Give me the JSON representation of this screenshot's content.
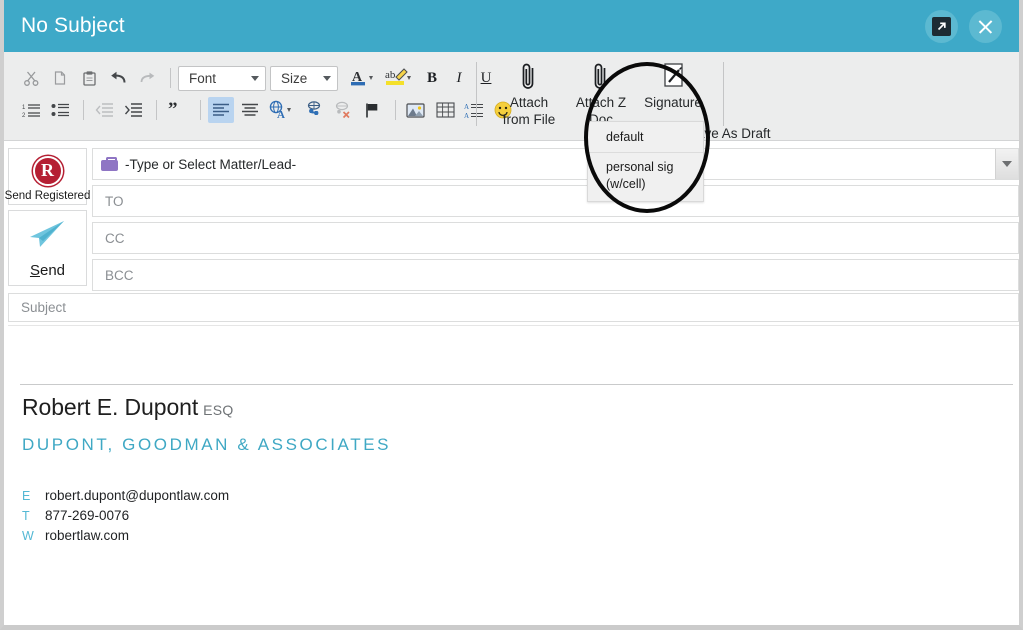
{
  "window": {
    "title": "No Subject",
    "popout_icon": "popout-arrow-icon",
    "close_icon": "close-icon",
    "header_color": "#3ea9c8"
  },
  "toolbar": {
    "row1": [
      {
        "name": "cut-button",
        "icon": "scissors-icon"
      },
      {
        "name": "copy-button",
        "icon": "copy-icon"
      },
      {
        "name": "paste-button",
        "icon": "clipboard-icon"
      },
      {
        "name": "undo-button",
        "icon": "undo-arrow-icon"
      },
      {
        "name": "redo-button",
        "icon": "redo-arrow-icon"
      }
    ],
    "font_select": {
      "label": "Font"
    },
    "size_select": {
      "label": "Size"
    },
    "row1_format": [
      {
        "name": "font-color-button",
        "icon": "font-color-icon"
      },
      {
        "name": "highlight-button",
        "icon": "highlighter-icon"
      },
      {
        "name": "bold-button",
        "icon": "bold-icon",
        "label": "B"
      },
      {
        "name": "italic-button",
        "icon": "italic-icon",
        "label": "I"
      },
      {
        "name": "underline-button",
        "icon": "underline-icon",
        "label": "U"
      }
    ],
    "row2": [
      {
        "name": "numbered-list-button",
        "icon": "numbered-list-icon"
      },
      {
        "name": "bullet-list-button",
        "icon": "bullet-list-icon"
      },
      {
        "name": "decrease-indent-button",
        "icon": "decrease-indent-icon"
      },
      {
        "name": "increase-indent-button",
        "icon": "increase-indent-icon"
      },
      {
        "name": "blockquote-button",
        "icon": "quote-icon"
      },
      {
        "name": "align-left-button",
        "icon": "align-left-icon"
      },
      {
        "name": "align-center-button",
        "icon": "align-center-icon"
      },
      {
        "name": "language-button",
        "icon": "globe-a-icon"
      },
      {
        "name": "insert-link-button",
        "icon": "link-icon"
      },
      {
        "name": "remove-link-button",
        "icon": "unlink-icon"
      },
      {
        "name": "flag-button",
        "icon": "flag-icon"
      },
      {
        "name": "insert-image-button",
        "icon": "image-icon"
      },
      {
        "name": "insert-table-button",
        "icon": "table-icon"
      },
      {
        "name": "paragraph-style-button",
        "icon": "paragraph-style-icon"
      },
      {
        "name": "emoji-button",
        "icon": "smiley-icon"
      }
    ],
    "attach_from_file": {
      "label": "Attach\nfrom File",
      "icon": "paperclip-icon"
    },
    "attach_z_doc": {
      "label": "Attach Z\nDoc",
      "icon": "paperclip-icon"
    },
    "signature": {
      "label": "Signature",
      "icon": "signature-pen-icon"
    },
    "save_as_draft": {
      "label": "Save As Draft"
    }
  },
  "signature_menu": {
    "items": [
      {
        "label": "default"
      },
      {
        "label": "personal sig"
      },
      {
        "label": "(w/cell)"
      }
    ]
  },
  "rail": {
    "send_registered": {
      "label": "Send Registered",
      "badge": "R",
      "badge_color": "#b51f33"
    },
    "send": {
      "label_prefix": "S",
      "label_rest": "end",
      "icon": "paper-plane-icon"
    }
  },
  "fields": {
    "matter": {
      "value": "-Type or Select Matter/Lead-",
      "icon": "briefcase-icon"
    },
    "to": {
      "placeholder": "TO"
    },
    "cc": {
      "placeholder": "CC"
    },
    "bcc": {
      "placeholder": "BCC"
    },
    "subject": {
      "placeholder": "Subject"
    }
  },
  "signature_block": {
    "name": "Robert E. Dupont",
    "suffix": "ESQ",
    "firm": "DUPONT, GOODMAN & ASSOCIATES",
    "firm_color": "#3fa8c4",
    "contacts": [
      {
        "key": "E",
        "value": "robert.dupont@dupontlaw.com"
      },
      {
        "key": "T",
        "value": "877-269-0076"
      },
      {
        "key": "W",
        "value": "robertlaw.com"
      }
    ]
  }
}
